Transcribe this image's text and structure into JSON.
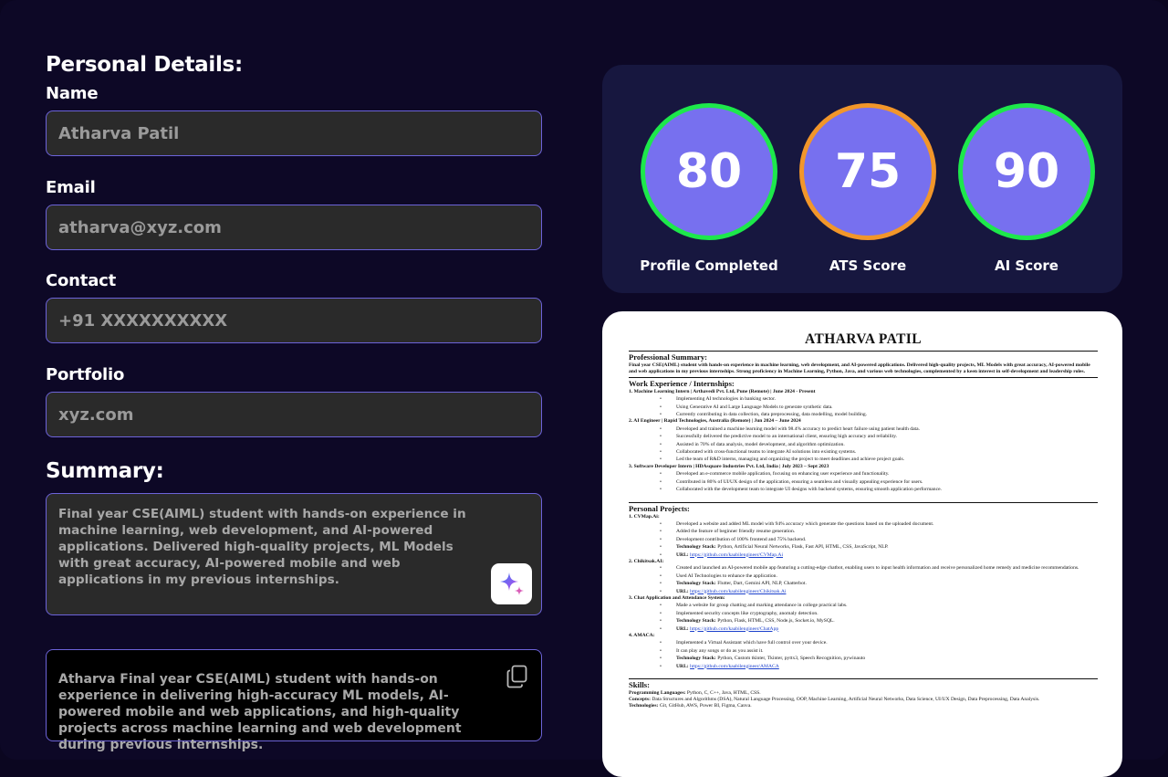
{
  "personal": {
    "title": "Personal Details:",
    "name_label": "Name",
    "name_value": "Atharva Patil",
    "email_label": "Email",
    "email_value": "atharva@xyz.com",
    "contact_label": "Contact",
    "contact_value": "+91 XXXXXXXXXX",
    "portfolio_label": "Portfolio",
    "portfolio_value": "xyz.com"
  },
  "summary": {
    "title": "Summary:",
    "text": "Final year CSE(AIML) student with hands-on experience in machine learning, web development, and AI-powered applications. Delivered high-quality projects, ML Models with great accuracy, AI-powered mobile and web applications in my previous internships.",
    "generated_text": "Atharva Final year CSE(AIML) student with hands-on experience in delivering high-accuracy ML models, AI-powered mobile and web applications, and high-quality projects across machine learning and web development during previous internships.",
    "ai_button_icon": "sparkle-icon",
    "copy_icon": "copy-icon"
  },
  "scores": [
    {
      "value": "80",
      "label": "Profile Completed",
      "ring_color": "#1de84b"
    },
    {
      "value": "75",
      "label": "ATS Score",
      "ring_color": "#f2962a"
    },
    {
      "value": "90",
      "label": "AI Score",
      "ring_color": "#1de84b"
    }
  ],
  "resume": {
    "name": "ATHARVA PATIL",
    "summary_head": "Professional Summary:",
    "summary_text": "Final year CSE(AIML) student with hands-on experience in machine learning, web development, and AI-powered applications. Delivered high-quality projects, ML Models with great accuracy, AI-powered mobile and web applications in my previous internships. Strong proficiency in Machine Learning, Python, Java, and various web technologies, complemented by a keen interest in self-development and leadership roles.",
    "work_head": "Work Experience / Internships:",
    "jobs": [
      {
        "title": "1. Machine Learning Intern | Arthavedi Pvt. Ltd, Pune (Remote) | June 2024 - Present",
        "bullets": [
          "Implementing AI technologies in banking sector.",
          "Using Generative AI and Large Language Models to generate synthetic data.",
          "Currently contributing in data collection, data preprocessing, data modelling, model building."
        ]
      },
      {
        "title": "2. AI Engineer | Rapid Technologies, Australia (Remote) | Jun 2024 – June 2024",
        "bullets": [
          "Developed and trained a machine learning model with 98.4% accuracy to predict heart failure using patient health data.",
          "Successfully delivered the predictive model to an international client, ensuring high accuracy and reliability.",
          "Assisted in 70% of data analysis, model development, and algorithm optimization.",
          "Collaborated with cross-functional teams to integrate AI solutions into existing systems.",
          "Led the team of R&D interns, managing and organizing the project to meet deadlines and achieve project goals."
        ]
      },
      {
        "title": "3. Software Developer Intern | HDAsquare Industries Pvt. Ltd, India | July 2023 – Sept 2023",
        "bullets": [
          "Developed an e-commerce mobile application, focusing on enhancing user experience and functionality.",
          "Contributed in 80% of UI/UX design of the application, ensuring a seamless and visually appealing experience for users.",
          "Collaborated with the development team to integrate UI designs with backend systems, ensuring smooth application performance."
        ]
      }
    ],
    "projects_head": "Personal Projects:",
    "projects": [
      {
        "title": "1. CVMap.Ai:",
        "bullets": [
          "Developed a website and added ML model with 94% accuracy which generate the questions based on the uploaded document.",
          "Added the feature of beginner friendly resume generation.",
          "Development contribution of 100% frontend and 75% backend."
        ],
        "stack_label": "Technology Stack:",
        "stack": "Python, Artificial Neural Networks, Flask, Fast API, HTML, CSS, JavaScript, NLP.",
        "url_label": "URL:",
        "url": "https://github.com/kaabilengineer/CVMap.Ai"
      },
      {
        "title": "2. Chikitsak.AI:",
        "bullets": [
          "Created and launched an AI-powered mobile app featuring a cutting-edge chatbot, enabling users to input health information and receive personalized home remedy and medicine recommendations.",
          "Used AI Technologies to enhance the application."
        ],
        "stack_label": "Technology Stack:",
        "stack": "Flutter, Dart, Gemini API, NLP, Chatterbot.",
        "url_label": "URL:",
        "url": "https://github.com/kaabilengineer/Chikitsak.Ai"
      },
      {
        "title": "3. Chat Application and Attendance System:",
        "bullets": [
          "Made a website for group chatting and marking attendance in college practical labs.",
          "Implemented security concepts like cryptography, anomaly detection."
        ],
        "stack_label": "Technology Stack:",
        "stack": "Python, Flask, HTML, CSS, Node.js, Socket.io, MySQL.",
        "url_label": "URL:",
        "url": "https://github.com/kaabilengineer/ChatApp"
      },
      {
        "title": "4. AMACA:",
        "bullets": [
          "Implemented a Virtual Assistant which have full control over your device.",
          "It can play any songs or do as you assist it."
        ],
        "stack_label": "Technology Stack:",
        "stack": "Python, Custom tkinter, Tkinter, pyttx3, Speech Recognition, pywinauto",
        "url_label": "URL:",
        "url": "https://github.com/kaabilengineer/AMACA"
      }
    ],
    "skills_head": "Skills:",
    "skills": [
      {
        "label": "Programming Languages:",
        "value": "Python, C, C++, Java, HTML, CSS."
      },
      {
        "label": "Concepts:",
        "value": "Data Structures and Algorithms (DSA), Natural Language Processing, OOP, Machine Learning, Artificial Neural Networks, Data Science, UI/UX Design, Data Preprocessing, Data Analysis."
      },
      {
        "label": "Technologies:",
        "value": "Git, GitHub, AWS, Power BI, Figma, Canva."
      }
    ]
  }
}
